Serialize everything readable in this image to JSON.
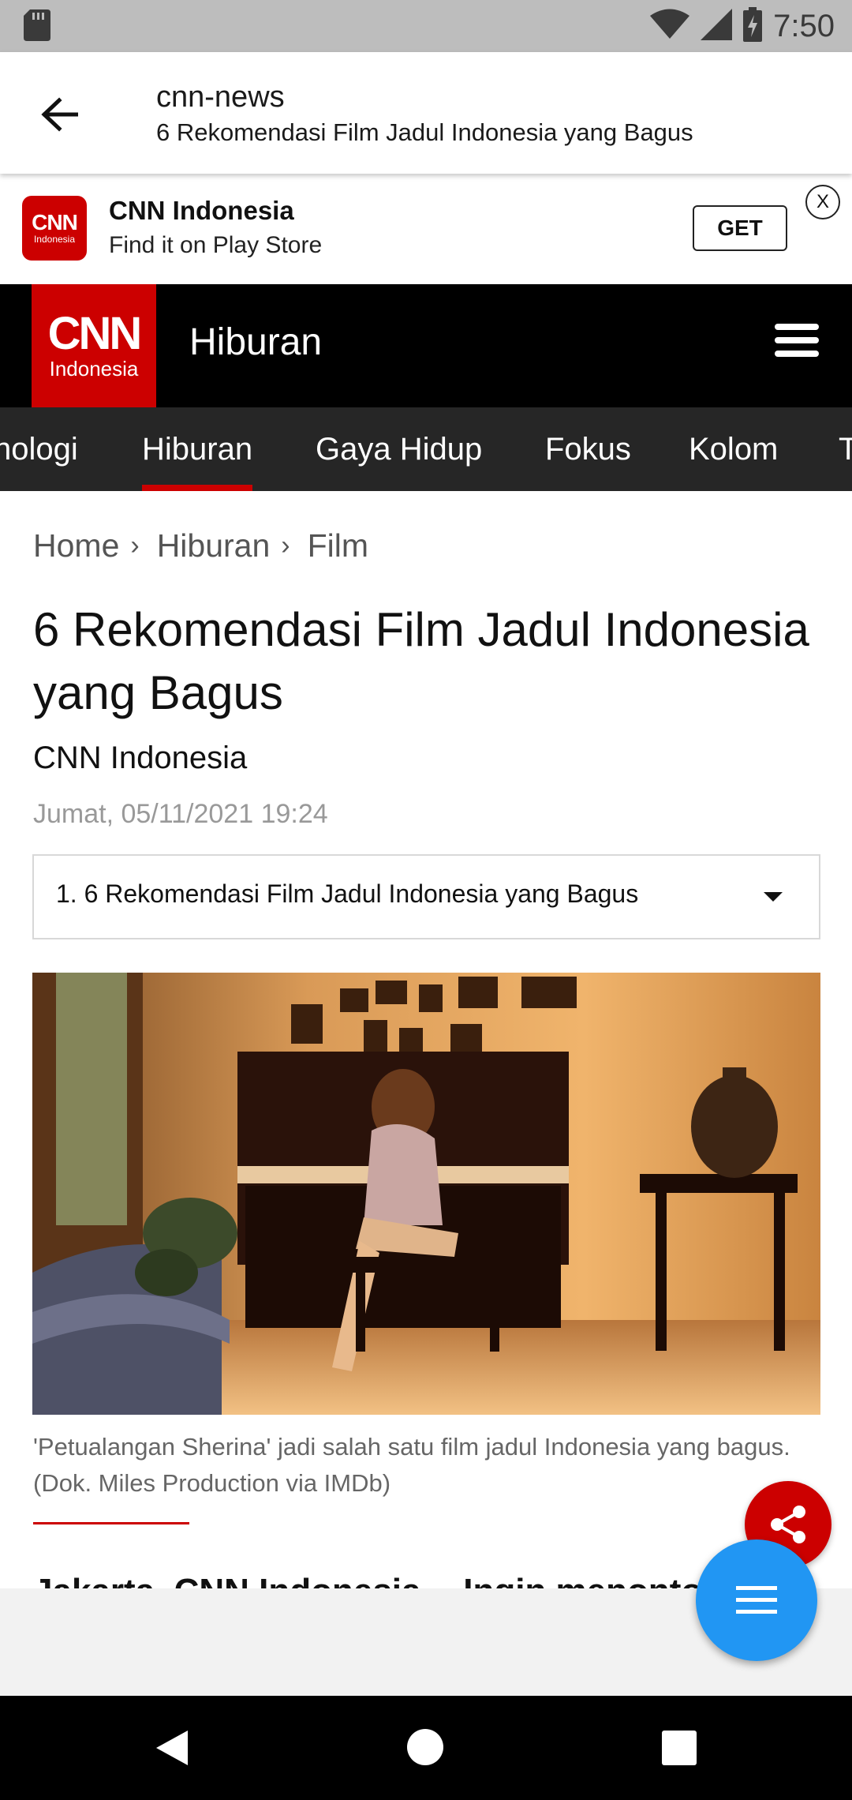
{
  "status_bar": {
    "time": "7:50"
  },
  "app_bar": {
    "title": "cnn-news",
    "subtitle": "6 Rekomendasi Film Jadul Indonesia yang Bagus"
  },
  "promo": {
    "logo_top": "CNN",
    "logo_bottom": "Indonesia",
    "app_name": "CNN Indonesia",
    "tagline": "Find it on Play Store",
    "get_label": "GET",
    "close_label": "X"
  },
  "header": {
    "logo_top": "CNN",
    "logo_bottom": "Indonesia",
    "section": "Hiburan"
  },
  "nav_tabs": [
    {
      "label": "nologi",
      "active": false
    },
    {
      "label": "Hiburan",
      "active": true
    },
    {
      "label": "Gaya Hidup",
      "active": false
    },
    {
      "label": "Fokus",
      "active": false
    },
    {
      "label": "Kolom",
      "active": false
    },
    {
      "label": "T",
      "active": false
    }
  ],
  "breadcrumb": [
    "Home",
    "Hiburan",
    "Film"
  ],
  "article": {
    "title": "6 Rekomendasi Film Jadul Indonesia yang Bagus",
    "author": "CNN Indonesia",
    "date": "Jumat, 05/11/2021 19:24",
    "toc_selected": "1. 6 Rekomendasi Film Jadul Indonesia yang Bagus",
    "caption": "'Petualangan Sherina' jadi salah satu film jadul Indonesia yang bagus. (Dok. Miles Production via IMDb)",
    "body_lead": "Jakarta, CNN Indonesia -- Ingin menonton"
  },
  "colors": {
    "accent_red": "#cc0000",
    "fab_blue": "#2196f3",
    "nav_dark": "#262626"
  }
}
